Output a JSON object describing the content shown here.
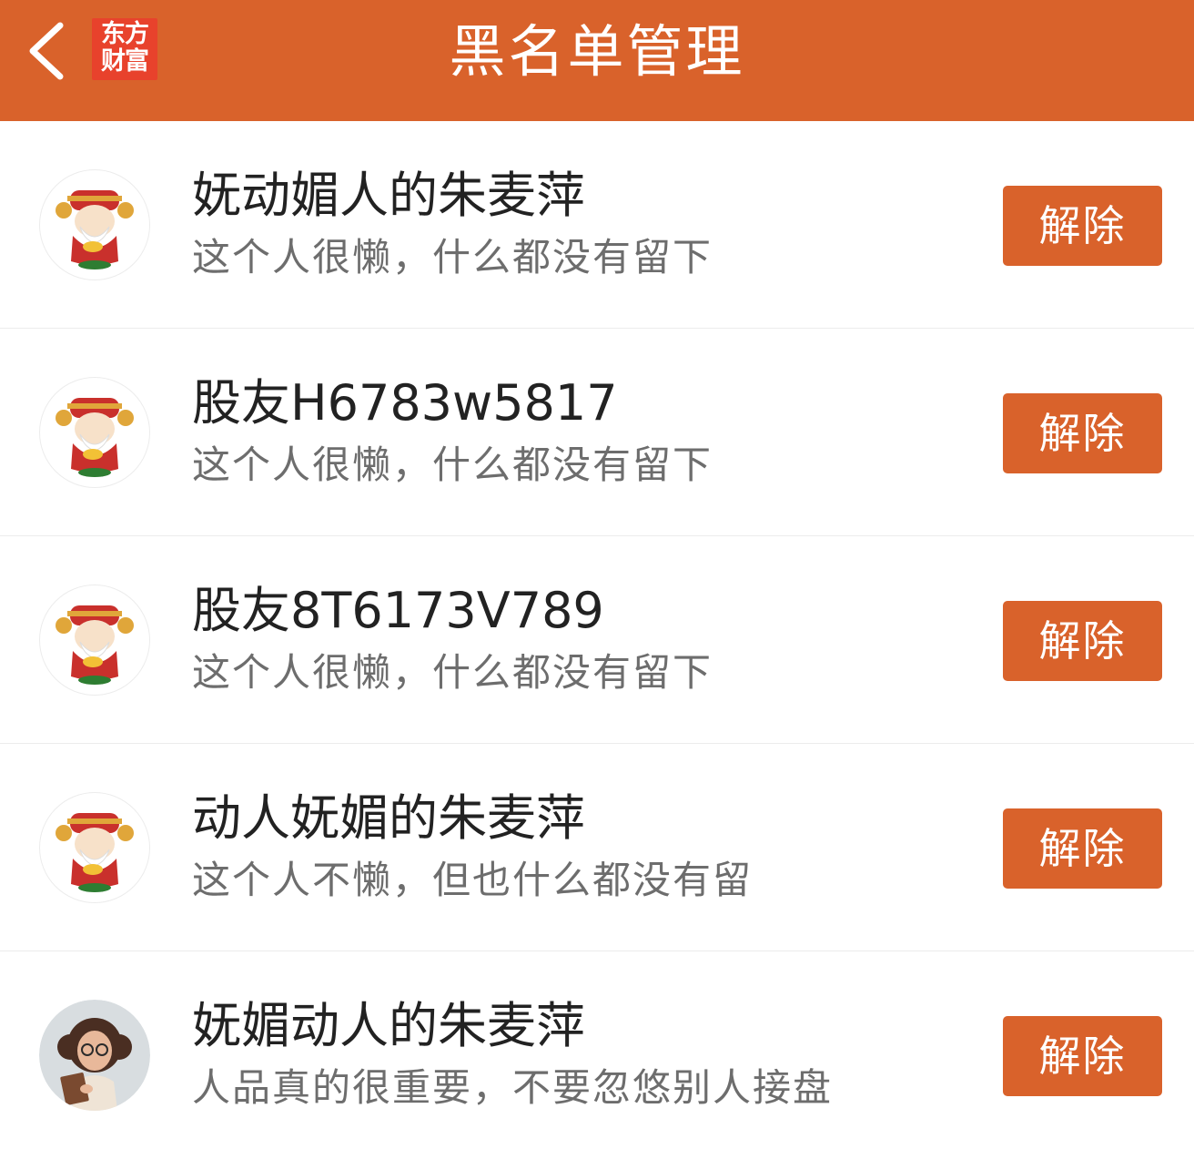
{
  "header": {
    "title": "黑名单管理",
    "logo_line1": "东方",
    "logo_line2": "财富",
    "back_icon": "chevron-left-icon"
  },
  "colors": {
    "brand": "#d9622b",
    "logo_red": "#e8422c",
    "name_text": "#222222",
    "bio_text": "#6d6d6d"
  },
  "blacklist": [
    {
      "name": "妩动媚人的朱麦萍",
      "bio": "这个人很懒，什么都没有留下",
      "button": "解除",
      "avatar": "caishen-avatar"
    },
    {
      "name": "股友H6783w5817",
      "bio": "这个人很懒，什么都没有留下",
      "button": "解除",
      "avatar": "caishen-avatar"
    },
    {
      "name": "股友8T6173V789",
      "bio": "这个人很懒，什么都没有留下",
      "button": "解除",
      "avatar": "caishen-avatar"
    },
    {
      "name": "动人妩媚的朱麦萍",
      "bio": "这个人不懒，但也什么都没有留",
      "button": "解除",
      "avatar": "caishen-avatar"
    },
    {
      "name": "妩媚动人的朱麦萍",
      "bio": "人品真的很重要，不要忽悠别人接盘",
      "button": "解除",
      "avatar": "girl-reading-avatar"
    }
  ]
}
